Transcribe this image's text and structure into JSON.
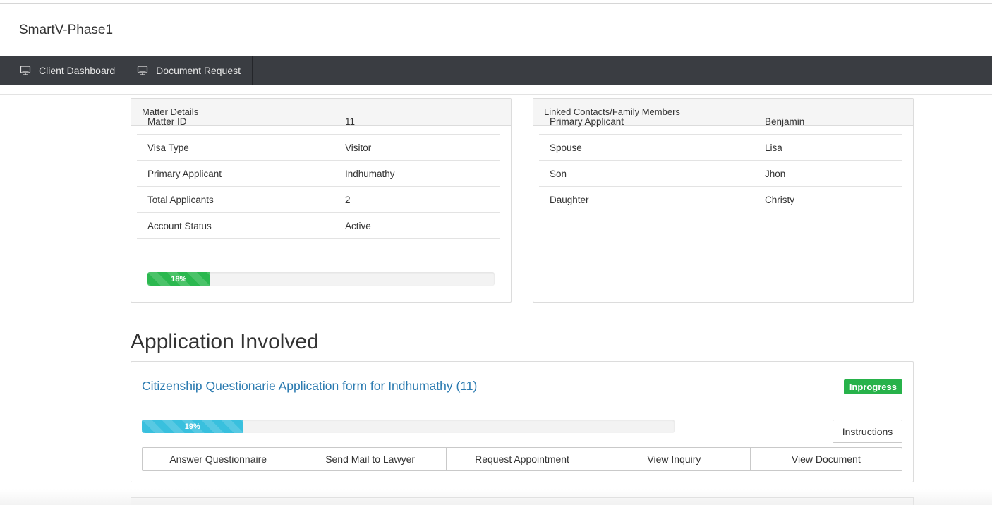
{
  "app": {
    "brand": "SmartV-Phase1"
  },
  "nav": {
    "items": [
      {
        "label": "Client Dashboard",
        "icon": "monitor-icon"
      },
      {
        "label": "Document Request",
        "icon": "monitor-icon"
      }
    ]
  },
  "matter": {
    "title": "Matter Details",
    "rows": [
      {
        "label": "Matter ID",
        "value": "11"
      },
      {
        "label": "Visa Type",
        "value": "Visitor"
      },
      {
        "label": "Primary Applicant",
        "value": "Indhumathy"
      },
      {
        "label": "Total Applicants",
        "value": "2"
      },
      {
        "label": "Account Status",
        "value": "Active"
      }
    ],
    "progress_label": "18%",
    "progress": 0.18
  },
  "contacts": {
    "title": "Linked Contacts/Family Members",
    "rows": [
      {
        "label": "Primary Applicant",
        "value": "Benjamin"
      },
      {
        "label": "Spouse",
        "value": "Lisa"
      },
      {
        "label": "Son",
        "value": "Jhon"
      },
      {
        "label": "Daughter",
        "value": "Christy"
      }
    ]
  },
  "applications": {
    "heading": "Application Involved",
    "items": [
      {
        "title": "Citizenship Questionarie Application form for Indhumathy (11)",
        "status": "Inprogress",
        "status_color": "#27b24a",
        "progress_label": "19%",
        "progress": 0.19,
        "instructions_label": "Instructions",
        "actions": [
          "Answer Questionnaire",
          "Send Mail to Lawyer",
          "Request Appointment",
          "View Inquiry",
          "View Document"
        ]
      }
    ]
  },
  "colors": {
    "navbar": "#3a3d42",
    "link": "#2a7ab0",
    "progress_green": "#2bb84f",
    "progress_blue": "#39c0de"
  }
}
